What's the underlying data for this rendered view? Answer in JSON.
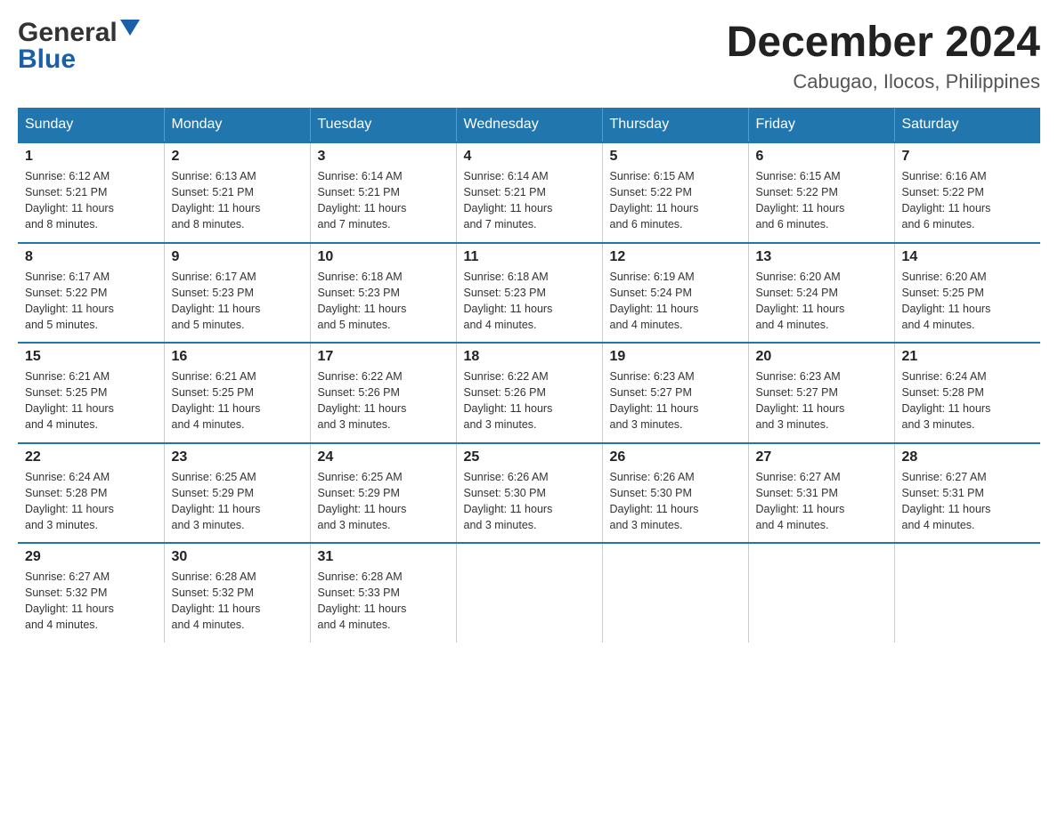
{
  "logo": {
    "text_general": "General",
    "arrow": "▲",
    "text_blue": "Blue"
  },
  "title": "December 2024",
  "location": "Cabugao, Ilocos, Philippines",
  "days_of_week": [
    "Sunday",
    "Monday",
    "Tuesday",
    "Wednesday",
    "Thursday",
    "Friday",
    "Saturday"
  ],
  "weeks": [
    [
      {
        "day": "1",
        "sunrise": "6:12 AM",
        "sunset": "5:21 PM",
        "daylight": "11 hours and 8 minutes."
      },
      {
        "day": "2",
        "sunrise": "6:13 AM",
        "sunset": "5:21 PM",
        "daylight": "11 hours and 8 minutes."
      },
      {
        "day": "3",
        "sunrise": "6:14 AM",
        "sunset": "5:21 PM",
        "daylight": "11 hours and 7 minutes."
      },
      {
        "day": "4",
        "sunrise": "6:14 AM",
        "sunset": "5:21 PM",
        "daylight": "11 hours and 7 minutes."
      },
      {
        "day": "5",
        "sunrise": "6:15 AM",
        "sunset": "5:22 PM",
        "daylight": "11 hours and 6 minutes."
      },
      {
        "day": "6",
        "sunrise": "6:15 AM",
        "sunset": "5:22 PM",
        "daylight": "11 hours and 6 minutes."
      },
      {
        "day": "7",
        "sunrise": "6:16 AM",
        "sunset": "5:22 PM",
        "daylight": "11 hours and 6 minutes."
      }
    ],
    [
      {
        "day": "8",
        "sunrise": "6:17 AM",
        "sunset": "5:22 PM",
        "daylight": "11 hours and 5 minutes."
      },
      {
        "day": "9",
        "sunrise": "6:17 AM",
        "sunset": "5:23 PM",
        "daylight": "11 hours and 5 minutes."
      },
      {
        "day": "10",
        "sunrise": "6:18 AM",
        "sunset": "5:23 PM",
        "daylight": "11 hours and 5 minutes."
      },
      {
        "day": "11",
        "sunrise": "6:18 AM",
        "sunset": "5:23 PM",
        "daylight": "11 hours and 4 minutes."
      },
      {
        "day": "12",
        "sunrise": "6:19 AM",
        "sunset": "5:24 PM",
        "daylight": "11 hours and 4 minutes."
      },
      {
        "day": "13",
        "sunrise": "6:20 AM",
        "sunset": "5:24 PM",
        "daylight": "11 hours and 4 minutes."
      },
      {
        "day": "14",
        "sunrise": "6:20 AM",
        "sunset": "5:25 PM",
        "daylight": "11 hours and 4 minutes."
      }
    ],
    [
      {
        "day": "15",
        "sunrise": "6:21 AM",
        "sunset": "5:25 PM",
        "daylight": "11 hours and 4 minutes."
      },
      {
        "day": "16",
        "sunrise": "6:21 AM",
        "sunset": "5:25 PM",
        "daylight": "11 hours and 4 minutes."
      },
      {
        "day": "17",
        "sunrise": "6:22 AM",
        "sunset": "5:26 PM",
        "daylight": "11 hours and 3 minutes."
      },
      {
        "day": "18",
        "sunrise": "6:22 AM",
        "sunset": "5:26 PM",
        "daylight": "11 hours and 3 minutes."
      },
      {
        "day": "19",
        "sunrise": "6:23 AM",
        "sunset": "5:27 PM",
        "daylight": "11 hours and 3 minutes."
      },
      {
        "day": "20",
        "sunrise": "6:23 AM",
        "sunset": "5:27 PM",
        "daylight": "11 hours and 3 minutes."
      },
      {
        "day": "21",
        "sunrise": "6:24 AM",
        "sunset": "5:28 PM",
        "daylight": "11 hours and 3 minutes."
      }
    ],
    [
      {
        "day": "22",
        "sunrise": "6:24 AM",
        "sunset": "5:28 PM",
        "daylight": "11 hours and 3 minutes."
      },
      {
        "day": "23",
        "sunrise": "6:25 AM",
        "sunset": "5:29 PM",
        "daylight": "11 hours and 3 minutes."
      },
      {
        "day": "24",
        "sunrise": "6:25 AM",
        "sunset": "5:29 PM",
        "daylight": "11 hours and 3 minutes."
      },
      {
        "day": "25",
        "sunrise": "6:26 AM",
        "sunset": "5:30 PM",
        "daylight": "11 hours and 3 minutes."
      },
      {
        "day": "26",
        "sunrise": "6:26 AM",
        "sunset": "5:30 PM",
        "daylight": "11 hours and 3 minutes."
      },
      {
        "day": "27",
        "sunrise": "6:27 AM",
        "sunset": "5:31 PM",
        "daylight": "11 hours and 4 minutes."
      },
      {
        "day": "28",
        "sunrise": "6:27 AM",
        "sunset": "5:31 PM",
        "daylight": "11 hours and 4 minutes."
      }
    ],
    [
      {
        "day": "29",
        "sunrise": "6:27 AM",
        "sunset": "5:32 PM",
        "daylight": "11 hours and 4 minutes."
      },
      {
        "day": "30",
        "sunrise": "6:28 AM",
        "sunset": "5:32 PM",
        "daylight": "11 hours and 4 minutes."
      },
      {
        "day": "31",
        "sunrise": "6:28 AM",
        "sunset": "5:33 PM",
        "daylight": "11 hours and 4 minutes."
      },
      null,
      null,
      null,
      null
    ]
  ],
  "labels": {
    "sunrise": "Sunrise:",
    "sunset": "Sunset:",
    "daylight": "Daylight:"
  }
}
